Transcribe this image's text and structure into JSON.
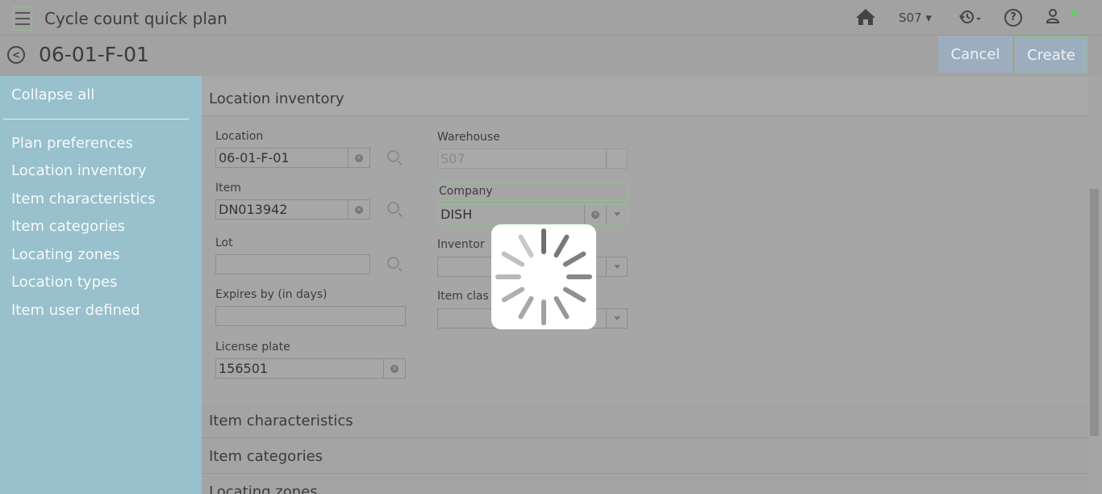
{
  "header": {
    "app_title": "Cycle count quick plan",
    "warehouse_selector": "S07 ▾",
    "icons": [
      "menu-icon",
      "home-icon",
      "history-icon",
      "help-icon",
      "user-icon"
    ]
  },
  "titlebar": {
    "title": "06-01-F-01",
    "cancel_label": "Cancel",
    "create_label": "Create"
  },
  "sidebar": {
    "collapse_all": "Collapse all",
    "items": [
      {
        "label": "Plan preferences"
      },
      {
        "label": "Location inventory"
      },
      {
        "label": "Item characteristics"
      },
      {
        "label": "Item categories"
      },
      {
        "label": "Locating zones"
      },
      {
        "label": "Location types"
      },
      {
        "label": "Item user defined"
      }
    ]
  },
  "location_inventory": {
    "heading": "Location inventory",
    "location": {
      "label": "Location",
      "value": "06-01-F-01"
    },
    "item": {
      "label": "Item",
      "value": "DN013942"
    },
    "lot": {
      "label": "Lot",
      "value": ""
    },
    "expires_by": {
      "label": "Expires by (in days)",
      "value": ""
    },
    "license_plate": {
      "label": "License plate",
      "value": "156501"
    },
    "warehouse": {
      "label": "Warehouse",
      "value": "S07"
    },
    "company": {
      "label": "Company",
      "value": "DISH"
    },
    "inventory": {
      "label": "Inventor",
      "value": ""
    },
    "item_class": {
      "label": "Item clas",
      "value": ""
    }
  },
  "sections": {
    "item_characteristics": "Item characteristics",
    "item_categories": "Item categories",
    "locating_zones": "Locating zones"
  },
  "colors": {
    "sidebar": "#98c0cd",
    "button": "#9cadbe",
    "focus_border": "#8fc08f",
    "status_dot": "#73c673"
  }
}
